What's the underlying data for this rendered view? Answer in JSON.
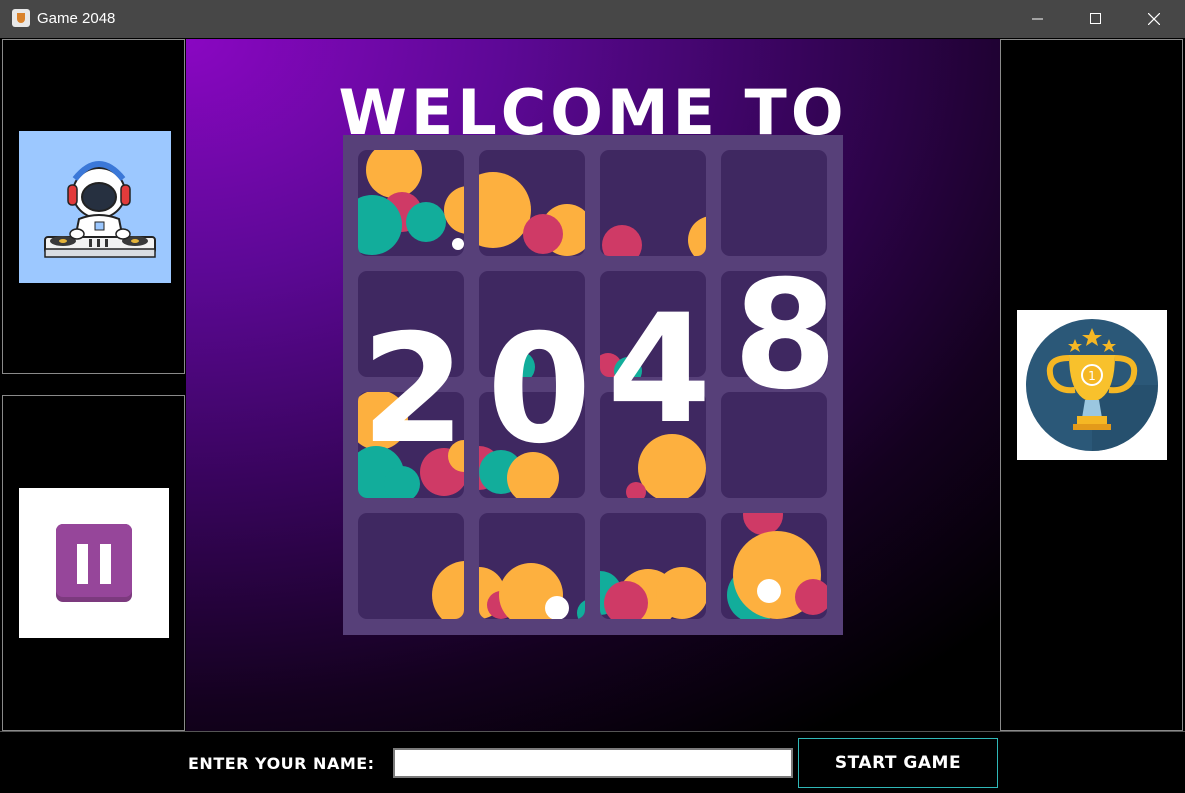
{
  "window": {
    "title": "Game 2048"
  },
  "welcome": {
    "heading": "WELCOME TO",
    "number": "2048"
  },
  "form": {
    "name_label": "ENTER YOUR NAME:",
    "name_value": "",
    "start_label": "START GAME"
  },
  "colors": {
    "tile_orange": "#fdb03f",
    "tile_teal": "#12ad9b",
    "tile_crimson": "#cf3a66",
    "board": "#574079",
    "tile": "#3f2861"
  },
  "icons": [
    "dj-astronaut-icon",
    "pause-icon",
    "trophy-icon"
  ]
}
